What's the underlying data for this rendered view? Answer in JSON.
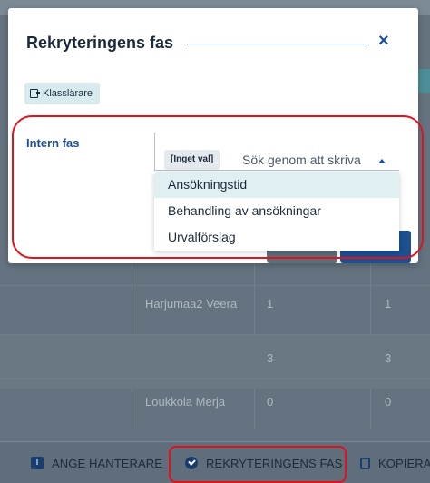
{
  "modal": {
    "title": "Rekryteringens fas",
    "close_symbol": "×",
    "chip_label": "Klasslärare",
    "field_label": "Intern fas",
    "selected_tag": "[Inget val]",
    "search_placeholder": "Sök genom att skriva",
    "options": [
      "Ansökningstid",
      "Behandling av ansökningar",
      "Urvalförslag"
    ],
    "highlighted_option_index": 0
  },
  "background_table": {
    "rows": [
      {
        "name": "Harjumaa2 Veera",
        "col1": "1",
        "col2": "1"
      },
      {
        "name": "",
        "col1": "3",
        "col2": "3"
      },
      {
        "name": "Loukkola Merja",
        "col1": "0",
        "col2": "0"
      }
    ]
  },
  "bottom_bar": {
    "items": [
      {
        "label": "ANGE HANTERARE",
        "icon": "flag-icon"
      },
      {
        "label": "REKRYTERINGENS FAS",
        "icon": "check-circle-icon"
      },
      {
        "label": "KOPIERA",
        "icon": "copy-icon"
      }
    ]
  },
  "colors": {
    "accent": "#1d4f91",
    "highlight": "#e1121b",
    "option_hover": "#dfeff2",
    "chip_bg": "#d9eaee"
  }
}
